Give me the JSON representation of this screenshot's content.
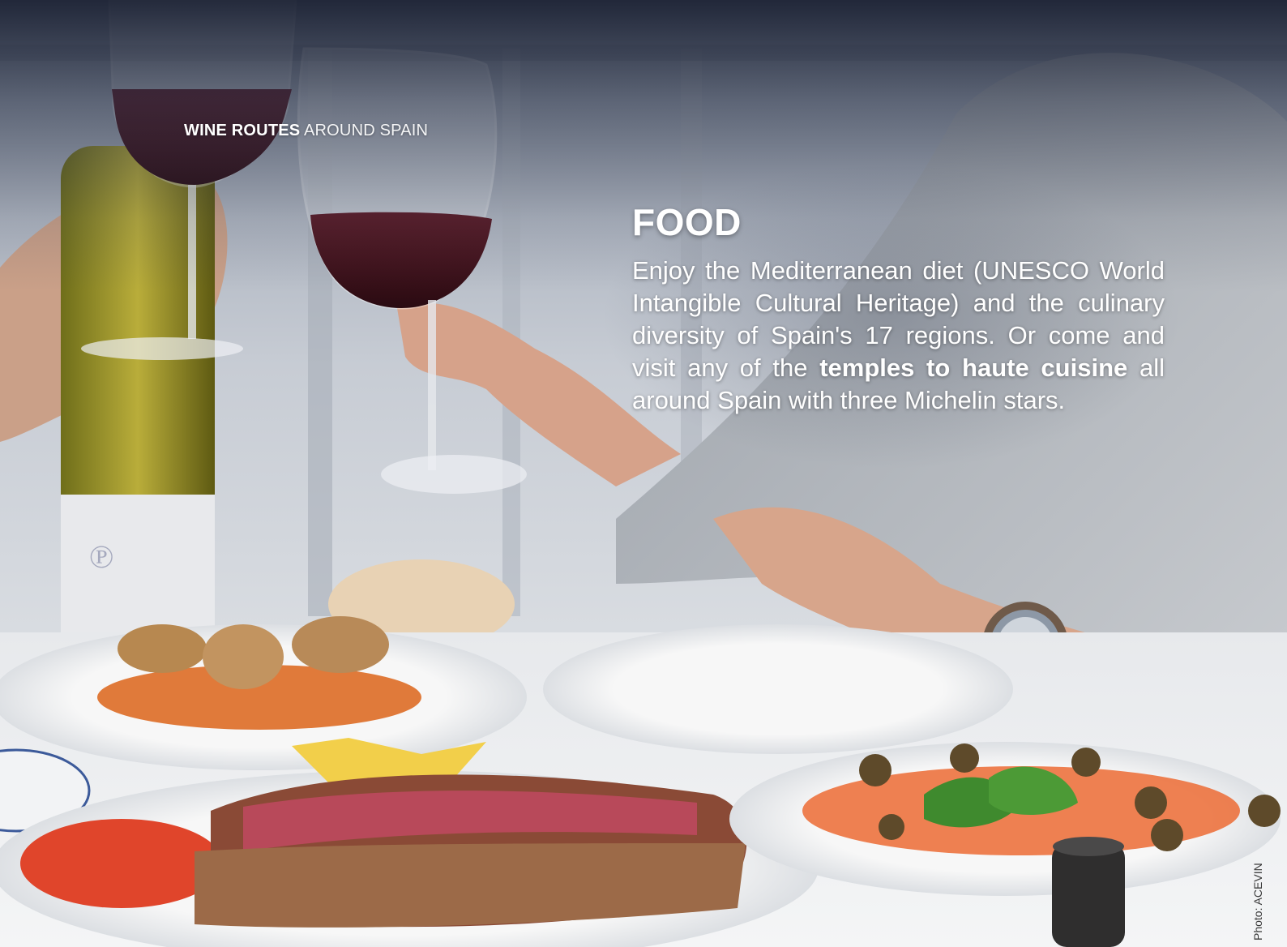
{
  "header": {
    "brand_bold": "WINE ROUTES",
    "brand_light": "AROUND SPAIN"
  },
  "section": {
    "title": "FOOD",
    "text_part1": "Enjoy the Mediterranean diet (UNESCO World Intangible Cultural Heritage) and the culinary diversity of Spain's 17 regions. Or come and visit any of the ",
    "text_bold": "temples to haute cuisine",
    "text_part2": " all around Spain with three Michelin stars."
  },
  "photo": {
    "credit": "Photo: ACEVIN"
  },
  "colors": {
    "text": "#ffffff",
    "shade": "#18203a",
    "tablecloth": "#eef0f2",
    "wine": "#3a1018"
  }
}
